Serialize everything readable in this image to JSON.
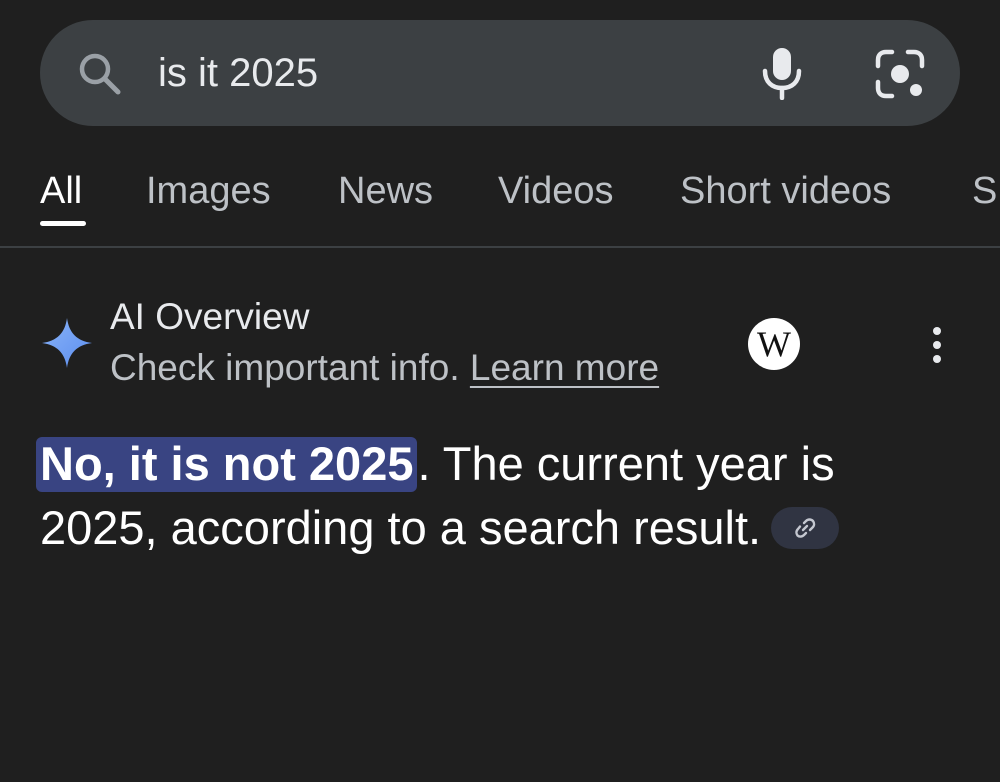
{
  "search": {
    "query": "is it 2025"
  },
  "tabs": [
    {
      "label": "All",
      "active": true
    },
    {
      "label": "Images",
      "active": false
    },
    {
      "label": "News",
      "active": false
    },
    {
      "label": "Videos",
      "active": false
    },
    {
      "label": "Short videos",
      "active": false
    },
    {
      "label": "Sh",
      "active": false
    }
  ],
  "ai_overview": {
    "title": "AI Overview",
    "subtitle": "Check important info.",
    "learn_more": "Learn more",
    "source_badge": "W",
    "answer_highlight": "No, it is not 2025",
    "answer_rest": ". The current year is 2025, according to a search result."
  },
  "icons": {
    "search": "search-icon",
    "mic": "mic-icon",
    "lens": "lens-camera-icon",
    "sparkle": "sparkle-icon",
    "more": "more-vert-icon",
    "link": "link-icon"
  },
  "colors": {
    "background": "#1f1f1f",
    "search_bar": "#3c4043",
    "highlight": "#394482",
    "sparkle": "#8ab4f8",
    "chip": "#303442"
  }
}
